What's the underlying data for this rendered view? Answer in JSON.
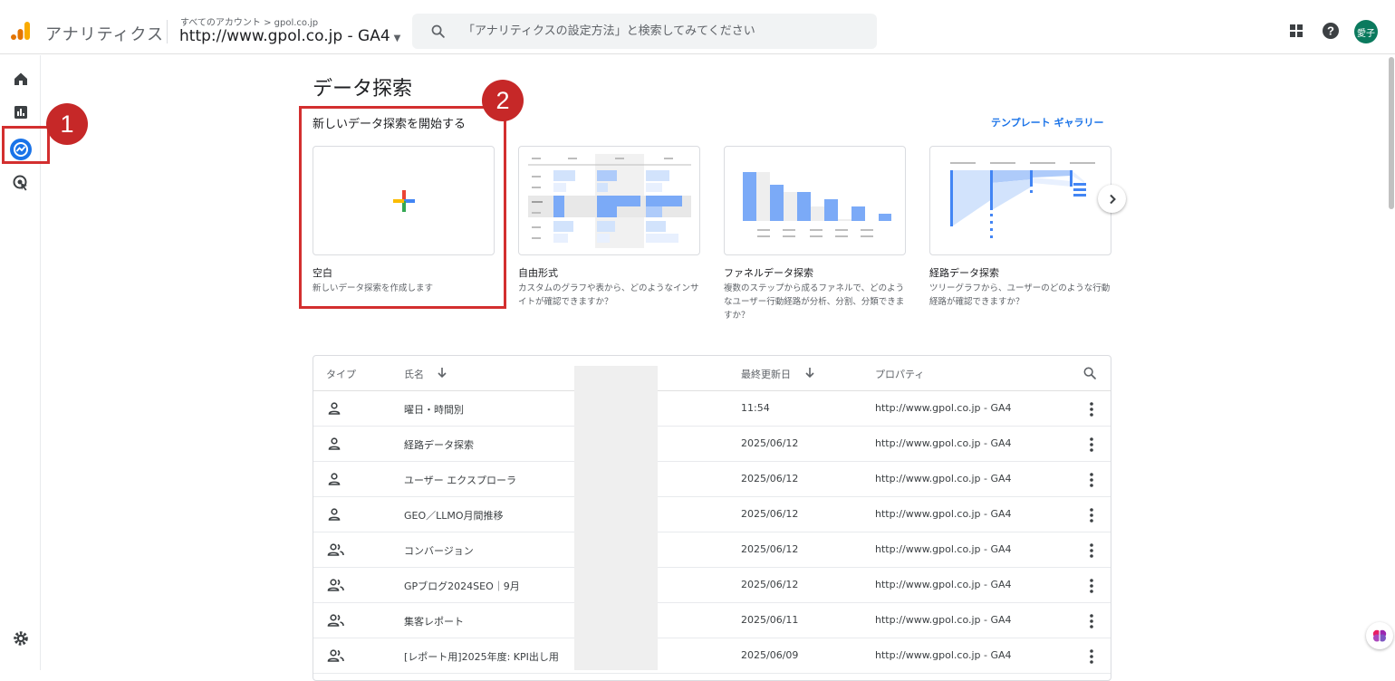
{
  "header": {
    "app_name": "アナリティクス",
    "breadcrumb": "すべてのアカウント > gpol.co.jp",
    "property": "http://www.gpol.co.jp - GA4",
    "search_placeholder": "「アナリティクスの設定方法」と検索してみてください",
    "avatar_text": "愛子",
    "avatar_color": "#0b7a5e"
  },
  "annotations": {
    "marker1": "1",
    "marker2": "2",
    "highlight_color": "#d32f2f"
  },
  "page": {
    "title": "データ探索",
    "section_title": "新しいデータ探索を開始する",
    "gallery_link": "テンプレート ギャラリー"
  },
  "templates": [
    {
      "title": "空白",
      "desc": "新しいデータ探索を作成します"
    },
    {
      "title": "自由形式",
      "desc": "カスタムのグラフや表から、どのようなインサイトが確認できますか？"
    },
    {
      "title": "ファネルデータ探索",
      "desc": "複数のステップから成るファネルで、どのようなユーザー行動経路が分析、分割、分類できますか？"
    },
    {
      "title": "経路データ探索",
      "desc": "ツリーグラフから、ユーザーのどのような行動経路が確認できますか？"
    }
  ],
  "table": {
    "headers": {
      "type": "タイプ",
      "name": "氏名",
      "modified": "最終更新日",
      "property": "プロパティ"
    },
    "rows": [
      {
        "type": "user",
        "name": "曜日・時間別",
        "modified": "11:54",
        "property": "http://www.gpol.co.jp - GA4"
      },
      {
        "type": "user",
        "name": "経路データ探索",
        "modified": "2025/06/12",
        "property": "http://www.gpol.co.jp - GA4"
      },
      {
        "type": "user",
        "name": "ユーザー エクスプローラ",
        "modified": "2025/06/12",
        "property": "http://www.gpol.co.jp - GA4"
      },
      {
        "type": "user",
        "name": "GEO／LLMO月間推移",
        "modified": "2025/06/12",
        "property": "http://www.gpol.co.jp - GA4"
      },
      {
        "type": "group",
        "name": "コンバージョン",
        "modified": "2025/06/12",
        "property": "http://www.gpol.co.jp - GA4"
      },
      {
        "type": "group",
        "name": "GPブログ2024SEO｜9月",
        "modified": "2025/06/12",
        "property": "http://www.gpol.co.jp - GA4"
      },
      {
        "type": "group",
        "name": "集客レポート",
        "modified": "2025/06/11",
        "property": "http://www.gpol.co.jp - GA4"
      },
      {
        "type": "group",
        "name": "[レポート用]2025年度: KPI出し用",
        "modified": "2025/06/09",
        "property": "http://www.gpol.co.jp - GA4"
      }
    ]
  }
}
